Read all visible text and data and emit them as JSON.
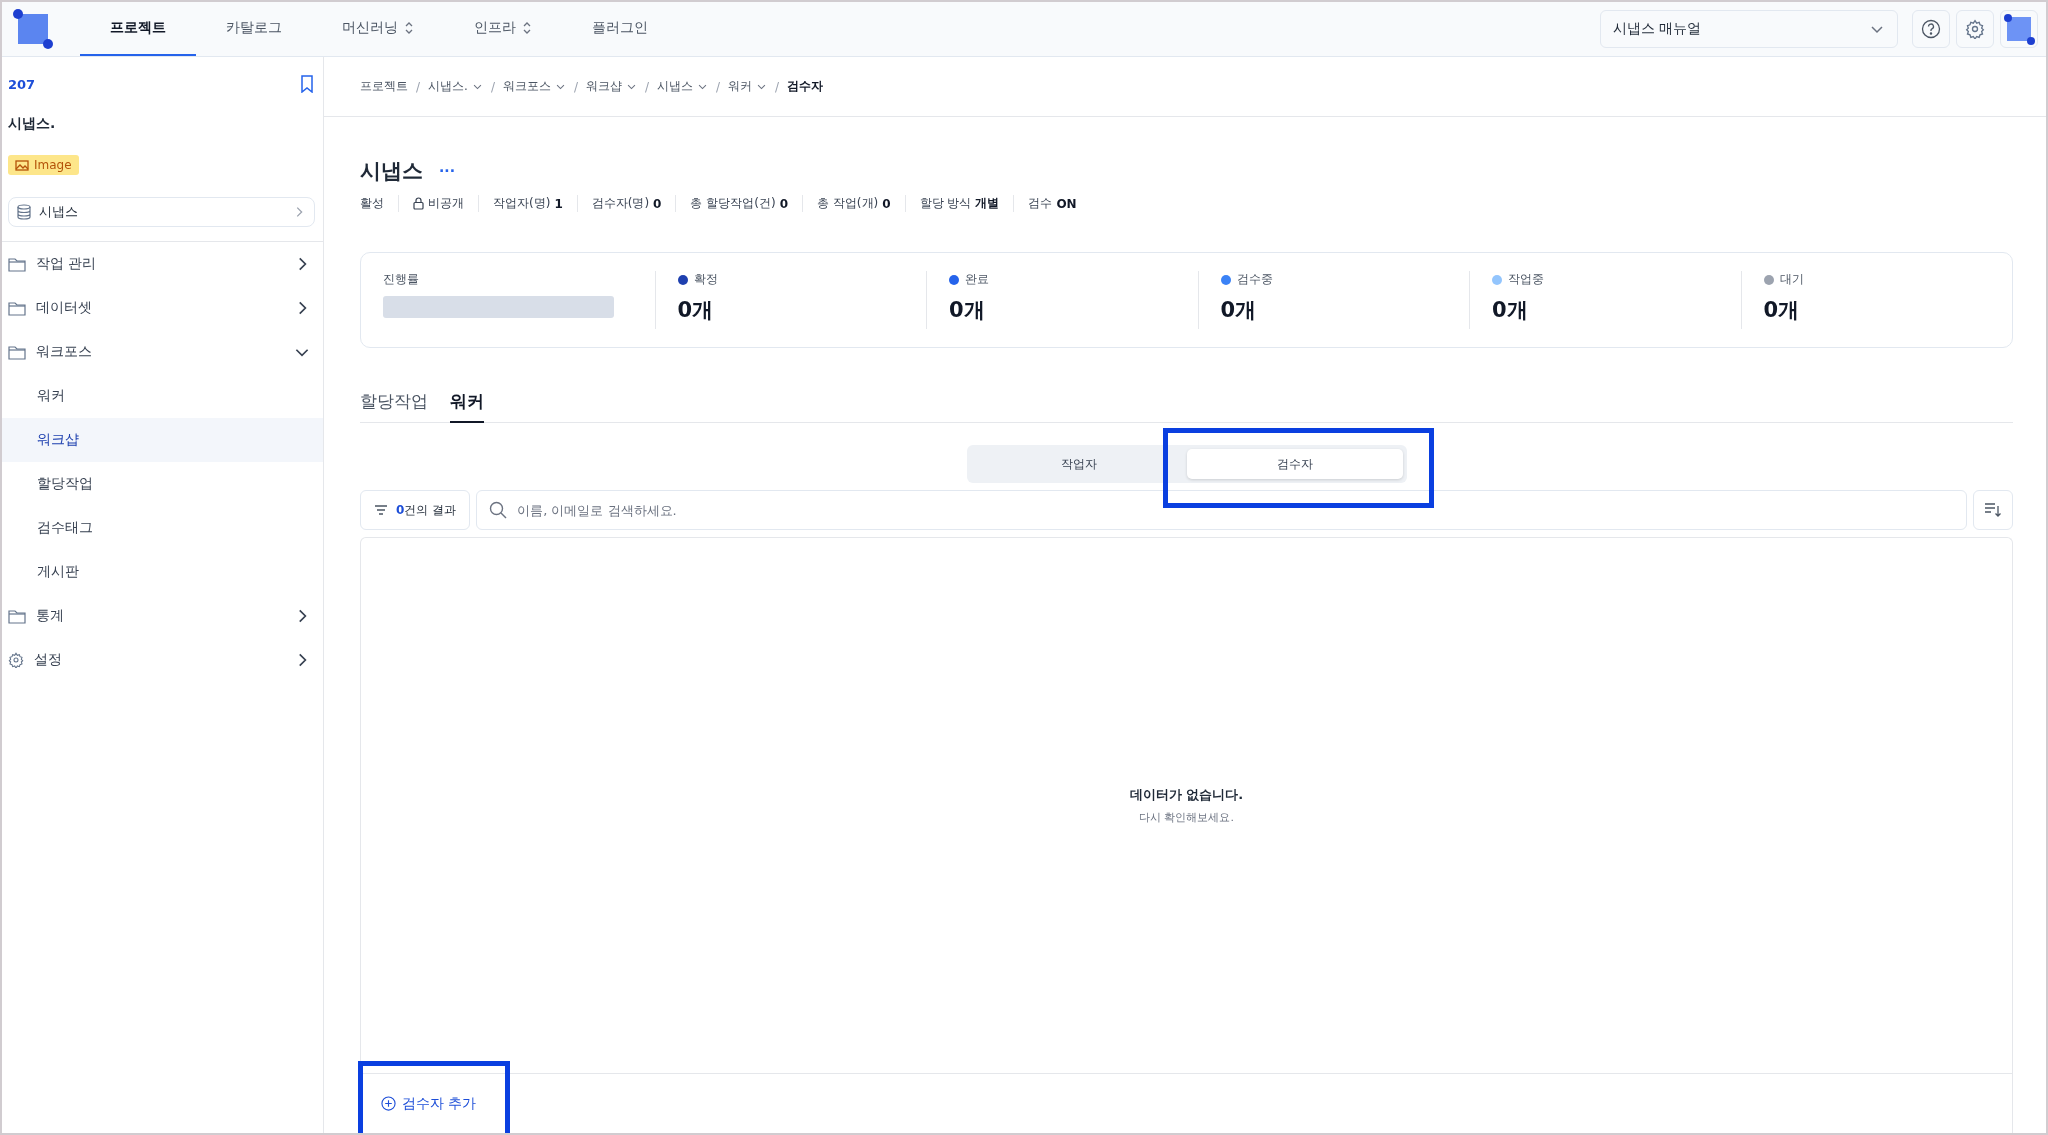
{
  "top_nav": {
    "tabs": [
      {
        "label": "프로젝트",
        "selected": true,
        "has_toggle": false
      },
      {
        "label": "카탈로그",
        "selected": false,
        "has_toggle": false
      },
      {
        "label": "머신러닝",
        "selected": false,
        "has_toggle": true
      },
      {
        "label": "인프라",
        "selected": false,
        "has_toggle": true
      },
      {
        "label": "플러그인",
        "selected": false,
        "has_toggle": false
      }
    ],
    "manual_select": {
      "value": "시냅스 매뉴얼"
    }
  },
  "sidebar": {
    "project_id": "207",
    "project_name": "시냅스.",
    "type_badge": "Image",
    "dataset_link": "시냅스",
    "items": [
      {
        "label": "작업 관리",
        "kind": "folder",
        "expanded": false,
        "selected": false
      },
      {
        "label": "데이터셋",
        "kind": "folder",
        "expanded": false,
        "selected": false
      },
      {
        "label": "워크포스",
        "kind": "folder",
        "expanded": true,
        "selected": false,
        "children": [
          {
            "label": "워커",
            "selected": false
          },
          {
            "label": "워크샵",
            "selected": true
          },
          {
            "label": "할당작업",
            "selected": false
          },
          {
            "label": "검수태그",
            "selected": false
          },
          {
            "label": "게시판",
            "selected": false
          }
        ]
      },
      {
        "label": "통계",
        "kind": "folder",
        "expanded": false,
        "selected": false
      },
      {
        "label": "설정",
        "kind": "gear",
        "expanded": false,
        "selected": false
      }
    ]
  },
  "breadcrumb_separator": "/",
  "breadcrumbs": [
    {
      "label": "프로젝트",
      "kind": "plain"
    },
    {
      "label": "시냅스.",
      "kind": "dropdown"
    },
    {
      "label": "워크포스",
      "kind": "dropdown"
    },
    {
      "label": "워크샵",
      "kind": "dropdown"
    },
    {
      "label": "시냅스",
      "kind": "dropdown"
    },
    {
      "label": "워커",
      "kind": "dropdown"
    },
    {
      "label": "검수자",
      "kind": "current"
    }
  ],
  "header": {
    "title": "시냅스",
    "more": "···",
    "meta": [
      {
        "kind": "text",
        "label": "활성"
      },
      {
        "kind": "lock",
        "label": "비공개"
      },
      {
        "kind": "pair",
        "label": "작업자(명)",
        "value": "1"
      },
      {
        "kind": "pair",
        "label": "검수자(명)",
        "value": "0"
      },
      {
        "kind": "pair",
        "label": "총 할당작업(건)",
        "value": "0"
      },
      {
        "kind": "pair",
        "label": "총 작업(개)",
        "value": "0"
      },
      {
        "kind": "pair",
        "label": "할당 방식",
        "value": "개별"
      },
      {
        "kind": "pair",
        "label": "검수",
        "value": "ON"
      }
    ]
  },
  "progress": {
    "label": "진행률",
    "level": 0
  },
  "stats": [
    {
      "label": "확정",
      "value": "0개",
      "color": "#1e40af"
    },
    {
      "label": "완료",
      "value": "0개",
      "color": "#2563eb"
    },
    {
      "label": "검수중",
      "value": "0개",
      "color": "#3b82f6"
    },
    {
      "label": "작업중",
      "value": "0개",
      "color": "#93c5fd"
    },
    {
      "label": "대기",
      "value": "0개",
      "color": "#9ca3af"
    }
  ],
  "tabs": [
    {
      "label": "할당작업",
      "selected": false
    },
    {
      "label": "워커",
      "selected": true
    }
  ],
  "segments": [
    {
      "label": "작업자",
      "selected": false
    },
    {
      "label": "검수자",
      "selected": true
    }
  ],
  "filter": {
    "count": "0",
    "suffix": "건의 결과"
  },
  "search": {
    "placeholder": "이름, 이메일로 검색하세요."
  },
  "empty": {
    "title": "데이터가 없습니다.",
    "hint": "다시 확인해보세요."
  },
  "add_button": {
    "label": "검수자 추가"
  }
}
